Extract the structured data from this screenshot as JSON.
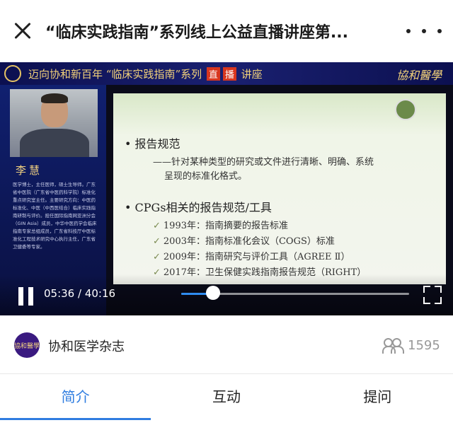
{
  "nav": {
    "title": "“临床实践指南”系列线上公益直播讲座第...",
    "close_icon": "close-icon",
    "more_icon": "more-dots-icon"
  },
  "video": {
    "banner": {
      "prefix": "迈向协和新百年  “临床实践指南”系列",
      "live_1": "直",
      "live_2": "播",
      "suffix": "讲座",
      "brand": "協和醫學"
    },
    "speaker": {
      "name": "李慧",
      "bio": "医学博士，主任医师，硕士生导师。广东省中医院（广东省中医药科学院）标准化重点研究室主任。主要研究方向：中医药标准化、中医（中西医结合）临床实践指南研制与评价。担任国际指南网亚洲分会（GIN Asia）成员，中华中医药学会临床指南专家总组成员，广东省科技厅中医标准化工程技术研究中心执行主任，广东省卫健委等专家。"
    },
    "slide": {
      "bullet_1": "报告规范",
      "sub_1_line1": "——针对某种类型的研究或文件进行清晰、明确、系统",
      "sub_1_line2": "呈现的标准化格式。",
      "bullet_2": "CPGs相关的报告规范/工具",
      "items": [
        "1993年：指南摘要的报告标准",
        "2003年：指南标准化会议（COGS）标准",
        "2009年：指南研究与评价工具（AGREE Ⅱ）",
        "2017年：卫生保健实践指南报告规范（RIGHT）"
      ]
    },
    "controls": {
      "time": "05:36 / 40:16",
      "progress": 0.14,
      "accent_color": "#2f8cf0"
    }
  },
  "channel": {
    "avatar_text": "協和醫學",
    "name": "协和医学杂志",
    "viewer_count": "1595",
    "viewer_icon": "viewers-icon"
  },
  "tabs": [
    {
      "label": "简介",
      "active": true
    },
    {
      "label": "互动",
      "active": false
    },
    {
      "label": "提问",
      "active": false
    }
  ]
}
